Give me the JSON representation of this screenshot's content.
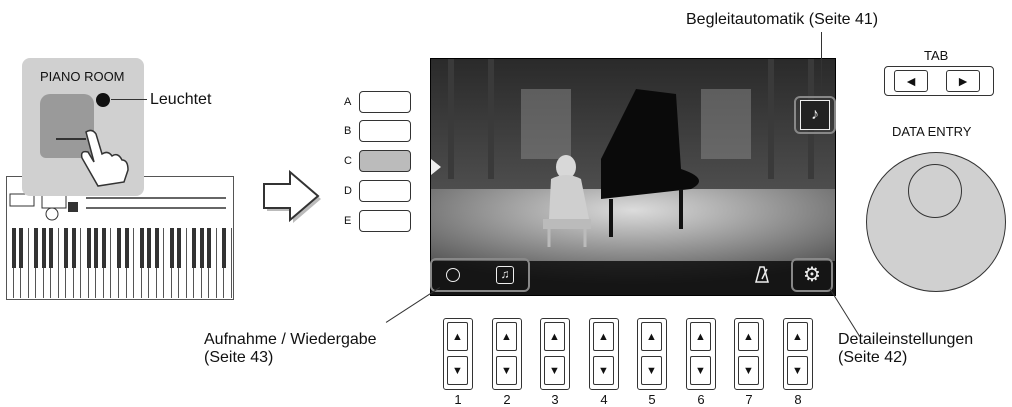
{
  "left": {
    "panel_label": "PIANO ROOM",
    "callout_label": "Leuchtet"
  },
  "screen": {
    "side_buttons": [
      "A",
      "B",
      "C",
      "D",
      "E"
    ],
    "active_side_button": "C"
  },
  "callouts": {
    "accompaniment": "Begleitautomatik (Seite 41)",
    "record_playback_line1": "Aufnahme / Wiedergabe",
    "record_playback_line2": "(Seite 43)",
    "details_line1": "Detaileinstellungen",
    "details_line2": "(Seite 42)"
  },
  "right": {
    "tab_label": "TAB",
    "tab_prev": "◄",
    "tab_next": "►",
    "data_entry_label": "DATA ENTRY"
  },
  "bottom_buttons": {
    "numbers": [
      "1",
      "2",
      "3",
      "4",
      "5",
      "6",
      "7",
      "8"
    ],
    "up_glyph": "▲",
    "down_glyph": "▼"
  },
  "icons": {
    "record": "record-icon",
    "song": "music-note-icon",
    "metronome": "metronome-icon",
    "settings": "gear-icon",
    "accompaniment": "drum-guitar-icon"
  }
}
